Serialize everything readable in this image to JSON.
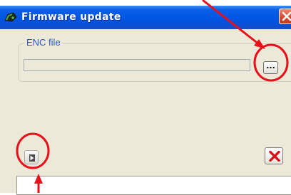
{
  "window": {
    "title": "Firmware update",
    "icon": "firmware-chip-icon"
  },
  "file_group": {
    "label": "ENC file",
    "path_value": "",
    "browse_label": "..."
  },
  "actions": {
    "start_icon": "play-icon",
    "cancel_icon": "red-x-icon"
  },
  "status": {
    "text": ""
  },
  "colors": {
    "title_bar": "#0055e5",
    "window_bg": "#ece9d8",
    "annotation": "#e8101a",
    "cancel_x": "#d4141a"
  }
}
